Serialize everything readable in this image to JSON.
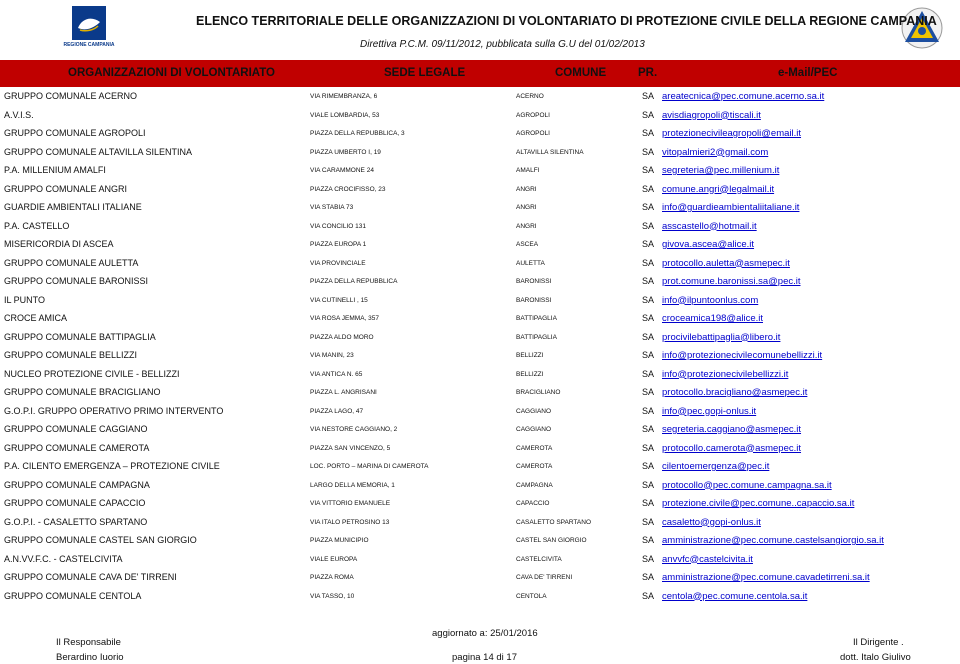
{
  "header": {
    "title": "ELENCO TERRITORIALE DELLE ORGANIZZAZIONI DI VOLONTARIATO DI PROTEZIONE CIVILE DELLA REGIONE CAMPANIA",
    "subtitle": "Direttiva P.C.M. 09/11/2012, pubblicata sulla G.U del 01/02/2013",
    "logo_text": "REGIONE CAMPANIA"
  },
  "columns": {
    "org": "ORGANIZZAZIONI DI VOLONTARIATO",
    "seat": "SEDE LEGALE",
    "comune": "COMUNE",
    "pr": "PR.",
    "email": "e-Mail/PEC"
  },
  "rows": [
    {
      "name": "GRUPPO COMUNALE ACERNO",
      "addr": "VIA RIMEMBRANZA, 6",
      "city": "ACERNO",
      "pr": "SA",
      "mail": "areatecnica@pec.comune.acerno.sa.it"
    },
    {
      "name": "A.V.I.S.",
      "addr": "VIALE LOMBARDIA, 53",
      "city": "AGROPOLI",
      "pr": "SA",
      "mail": "avisdiagropoli@tiscali.it"
    },
    {
      "name": "GRUPPO COMUNALE AGROPOLI",
      "addr": "PIAZZA DELLA REPUBBLICA, 3",
      "city": "AGROPOLI",
      "pr": "SA",
      "mail": "protezionecivileagropoli@email.it"
    },
    {
      "name": "GRUPPO COMUNALE ALTAVILLA SILENTINA",
      "addr": "PIAZZA UMBERTO I, 19",
      "city": "ALTAVILLA SILENTINA",
      "pr": "SA",
      "mail": "vitopalmieri2@gmail.com"
    },
    {
      "name": "P.A. MILLENIUM AMALFI",
      "addr": "VIA CARAMMONE 24",
      "city": "AMALFI",
      "pr": "SA",
      "mail": "segreteria@pec.millenium.it"
    },
    {
      "name": "GRUPPO COMUNALE ANGRI",
      "addr": "PIAZZA CROCIFISSO, 23",
      "city": "ANGRI",
      "pr": "SA",
      "mail": "comune.angri@legalmail.it"
    },
    {
      "name": "GUARDIE AMBIENTALI ITALIANE",
      "addr": "VIA STABIA 73",
      "city": "ANGRI",
      "pr": "SA",
      "mail": "info@guardieambientaliitaliane.it"
    },
    {
      "name": "P.A. CASTELLO",
      "addr": "VIA CONCILIO 131",
      "city": "ANGRI",
      "pr": "SA",
      "mail": "asscastello@hotmail.it"
    },
    {
      "name": "MISERICORDIA DI ASCEA",
      "addr": "PIAZZA EUROPA 1",
      "city": "ASCEA",
      "pr": "SA",
      "mail": "givova.ascea@alice.it"
    },
    {
      "name": "GRUPPO COMUNALE AULETTA",
      "addr": "VIA PROVINCIALE",
      "city": "AULETTA",
      "pr": "SA",
      "mail": "protocollo.auletta@asmepec.it"
    },
    {
      "name": "GRUPPO COMUNALE BARONISSI",
      "addr": "PIAZZA DELLA REPUBBLICA",
      "city": "BARONISSI",
      "pr": "SA",
      "mail": "prot.comune.baronissi.sa@pec.it"
    },
    {
      "name": "IL PUNTO",
      "addr": "VIA CUTINELLI , 15",
      "city": "BARONISSI",
      "pr": "SA",
      "mail": "info@ilpuntoonlus.com"
    },
    {
      "name": "CROCE AMICA",
      "addr": "VIA ROSA JEMMA, 357",
      "city": "BATTIPAGLIA",
      "pr": "SA",
      "mail": "croceamica198@alice.it"
    },
    {
      "name": "GRUPPO COMUNALE BATTIPAGLIA",
      "addr": "PIAZZA ALDO MORO",
      "city": "BATTIPAGLIA",
      "pr": "SA",
      "mail": "procivilebattipaglia@libero.it"
    },
    {
      "name": "GRUPPO COMUNALE BELLIZZI",
      "addr": "VIA MANIN, 23",
      "city": "BELLIZZI",
      "pr": "SA",
      "mail": "info@protezionecivilecomunebellizzi.it"
    },
    {
      "name": "NUCLEO PROTEZIONE CIVILE - BELLIZZI",
      "addr": "VIA ANTICA N. 65",
      "city": "BELLIZZI",
      "pr": "SA",
      "mail": "info@protezionecivilebellizzi.it"
    },
    {
      "name": "GRUPPO COMUNALE BRACIGLIANO",
      "addr": "PIAZZA L. ANGRISANI",
      "city": "BRACIGLIANO",
      "pr": "SA",
      "mail": "protocollo.bracigliano@asmepec.it"
    },
    {
      "name": "G.O.P.I. GRUPPO OPERATIVO PRIMO INTERVENTO",
      "addr": "PIAZZA LAGO, 47",
      "city": "CAGGIANO",
      "pr": "SA",
      "mail": "info@pec.gopi-onlus.it"
    },
    {
      "name": "GRUPPO COMUNALE CAGGIANO",
      "addr": "VIA NESTORE CAGGIANO, 2",
      "city": "CAGGIANO",
      "pr": "SA",
      "mail": "segreteria.caggiano@asmepec.it"
    },
    {
      "name": "GRUPPO COMUNALE CAMEROTA",
      "addr": "PIAZZA SAN VINCENZO, 5",
      "city": "CAMEROTA",
      "pr": "SA",
      "mail": "protocollo.camerota@asmepec.it"
    },
    {
      "name": "P.A. CILENTO EMERGENZA – PROTEZIONE CIVILE",
      "addr": "LOC. PORTO – MARINA DI CAMEROTA",
      "city": "CAMEROTA",
      "pr": "SA",
      "mail": "cilentoemergenza@pec.it"
    },
    {
      "name": "GRUPPO COMUNALE CAMPAGNA",
      "addr": "LARGO DELLA MEMORIA, 1",
      "city": "CAMPAGNA",
      "pr": "SA",
      "mail": "protocollo@pec.comune.campagna.sa.it"
    },
    {
      "name": "GRUPPO COMUNALE CAPACCIO",
      "addr": "VIA VITTORIO EMANUELE",
      "city": "CAPACCIO",
      "pr": "SA",
      "mail": "protezione.civile@pec.comune..capaccio.sa.it"
    },
    {
      "name": "G.O.P.I. - CASALETTO SPARTANO",
      "addr": "VIA ITALO PETROSINO 13",
      "city": "CASALETTO SPARTANO",
      "pr": "SA",
      "mail": "casaletto@gopi-onlus.it"
    },
    {
      "name": "GRUPPO COMUNALE CASTEL SAN GIORGIO",
      "addr": "PIAZZA MUNICIPIO",
      "city": "CASTEL SAN GIORGIO",
      "pr": "SA",
      "mail": "amministrazione@pec.comune.castelsangiorgio.sa.it"
    },
    {
      "name": "A.N.VV.F.C. - CASTELCIVITA",
      "addr": "VIALE  EUROPA",
      "city": "CASTELCIVITA",
      "pr": "SA",
      "mail": "anvvfc@castelcivita.it"
    },
    {
      "name": "GRUPPO COMUNALE CAVA DE' TIRRENI",
      "addr": "PIAZZA ROMA",
      "city": "CAVA DE' TIRRENI",
      "pr": "SA",
      "mail": "amministrazione@pec.comune.cavadetirreni.sa.it"
    },
    {
      "name": "GRUPPO COMUNALE CENTOLA",
      "addr": "VIA TASSO, 10",
      "city": "CENTOLA",
      "pr": "SA",
      "mail": "centola@pec.comune.centola.sa.it"
    }
  ],
  "footer": {
    "left_role": "Il Responsabile",
    "left_name": "Berardino Iuorio",
    "updated": "aggiornato a: 25/01/2016",
    "page": "pagina 14 di 17",
    "right_role": "Il Dirigente .",
    "right_name": "dott. Italo Giulivo"
  }
}
